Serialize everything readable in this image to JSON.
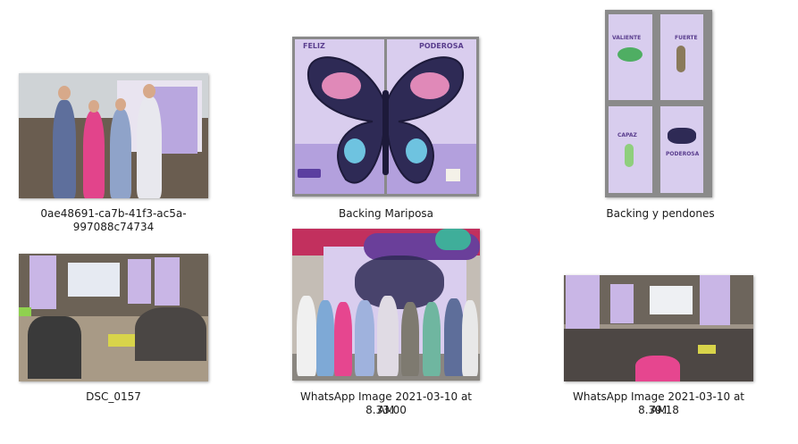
{
  "files": [
    {
      "name": "0ae48691-ca7b-41f3-ac5a-997088c74734",
      "type": "photo"
    },
    {
      "name": "Backing Mariposa",
      "type": "artwork"
    },
    {
      "name": "Backing y pendones",
      "type": "artwork"
    },
    {
      "name": "DSC_0157",
      "type": "photo"
    },
    {
      "name": "WhatsApp Image 2021-03-10 at 8.33.00 AM",
      "line1": "WhatsApp Image 2021-03-10 at 8.33.00",
      "line2": "AM",
      "type": "photo"
    },
    {
      "name": "WhatsApp Image 2021-03-10 at 8.39.18 AM",
      "line1": "WhatsApp Image 2021-03-10 at 8.39.18",
      "line2": "AM",
      "type": "photo"
    }
  ],
  "artwork_text": {
    "left_panel": "FELIZ",
    "right_panel": "PODEROSA",
    "p1": "VALIENTE",
    "p2": "FUERTE",
    "p3": "CAPAZ",
    "p4": "PODEROSA"
  },
  "colors": {
    "purple": "#6b3fa0",
    "lavender": "#d6c6ef",
    "pink": "#e8559a",
    "teal": "#27b3a8",
    "grey_frame": "#8a8a8a"
  }
}
